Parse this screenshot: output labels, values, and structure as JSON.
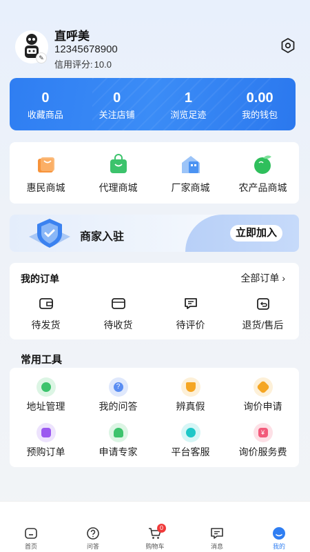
{
  "profile": {
    "name": "直呼美",
    "phone": "12345678900",
    "credit_label": "信用评分:",
    "credit_value": "10.0",
    "avatar_icon": "robot-avatar-icon",
    "settings_icon": "settings-icon"
  },
  "stats": [
    {
      "value": "0",
      "label": "收藏商品"
    },
    {
      "value": "0",
      "label": "关注店铺"
    },
    {
      "value": "1",
      "label": "浏览足迹"
    },
    {
      "value": "0.00",
      "label": "我的钱包"
    }
  ],
  "malls": [
    {
      "label": "惠民商城",
      "icon": "shopping-bag-orange-icon",
      "color": "#f7933a"
    },
    {
      "label": "代理商城",
      "icon": "shopping-bag-green-icon",
      "color": "#3cc36c"
    },
    {
      "label": "厂家商城",
      "icon": "factory-building-icon",
      "color": "#4b93f2"
    },
    {
      "label": "农产品商城",
      "icon": "apple-icon",
      "color": "#2fbf5c"
    }
  ],
  "banner": {
    "title": "商家入驻",
    "button": "立即加入"
  },
  "orders": {
    "title": "我的订单",
    "all_label": "全部订单",
    "items": [
      {
        "label": "待发货",
        "icon": "wallet-icon"
      },
      {
        "label": "待收货",
        "icon": "card-icon"
      },
      {
        "label": "待评价",
        "icon": "message-icon"
      },
      {
        "label": "退货/售后",
        "icon": "return-icon"
      }
    ]
  },
  "tools": {
    "title": "常用工具",
    "items": [
      {
        "label": "地址管理",
        "icon": "location-icon",
        "color": "#3cc36c"
      },
      {
        "label": "我的问答",
        "icon": "question-icon",
        "color": "#5a8df2"
      },
      {
        "label": "辨真假",
        "icon": "trophy-icon",
        "color": "#f5a623"
      },
      {
        "label": "询价申请",
        "icon": "tag-icon",
        "color": "#f5a623"
      },
      {
        "label": "预购订单",
        "icon": "document-icon",
        "color": "#9b59f0"
      },
      {
        "label": "申请专家",
        "icon": "expert-icon",
        "color": "#3cc36c"
      },
      {
        "label": "平台客服",
        "icon": "headset-icon",
        "color": "#1fc7c7"
      },
      {
        "label": "询价服务费",
        "icon": "fee-icon",
        "color": "#f25a7a"
      }
    ]
  },
  "tabbar": {
    "items": [
      {
        "label": "首页",
        "icon": "home-icon"
      },
      {
        "label": "问答",
        "icon": "question-circle-icon"
      },
      {
        "label": "购物车",
        "icon": "cart-icon",
        "badge": "0"
      },
      {
        "label": "消息",
        "icon": "chat-icon"
      },
      {
        "label": "我的",
        "icon": "profile-icon",
        "active": true
      }
    ],
    "accent": "#2f7ef2"
  }
}
